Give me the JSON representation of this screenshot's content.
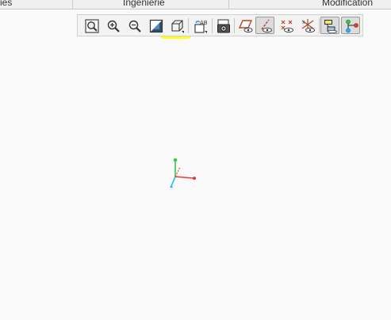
{
  "ribbon": {
    "tabs": [
      {
        "label": "ies"
      },
      {
        "label": "Ingénierie"
      },
      {
        "label": "Modification"
      }
    ]
  },
  "view_toolbar": {
    "buttons": [
      {
        "name": "refit",
        "icon": "zoom-fit-icon"
      },
      {
        "name": "zoom-in",
        "icon": "zoom-in-icon"
      },
      {
        "name": "zoom-out",
        "icon": "zoom-out-icon"
      },
      {
        "name": "repaint",
        "icon": "repaint-icon"
      },
      {
        "name": "saved-orientations",
        "icon": "saved-views-cube-icon",
        "highlighted": true
      },
      {
        "name": "view-manager",
        "icon": "view-manager-icon"
      },
      {
        "name": "display-style",
        "icon": "display-style-camera-icon"
      },
      {
        "name": "datum-planes",
        "icon": "datum-plane-display-icon"
      },
      {
        "name": "datum-axes",
        "icon": "datum-axis-display-icon",
        "active": true
      },
      {
        "name": "datum-points",
        "icon": "datum-point-display-icon"
      },
      {
        "name": "coordinate-systems",
        "icon": "coordinate-system-display-icon"
      },
      {
        "name": "annotations",
        "icon": "annotation-display-icon",
        "active": true
      },
      {
        "name": "spin-center",
        "icon": "spin-center-icon",
        "active": true
      }
    ],
    "highlight_color": "#fcff1e"
  },
  "graphics_area": {
    "background": "#fafafa",
    "triad_colors": {
      "x": "#e53935",
      "y": "#2ecc40",
      "z": "#29b6f6"
    }
  }
}
